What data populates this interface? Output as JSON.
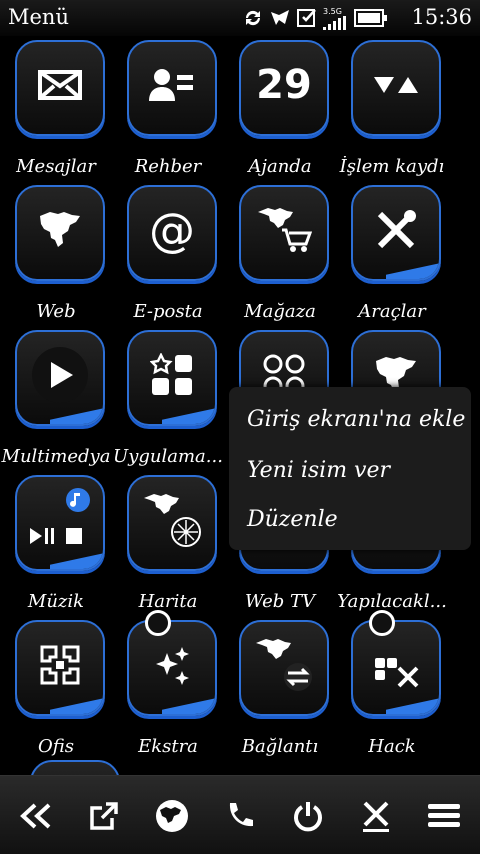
{
  "status": {
    "title": "Menü",
    "time": "15:36",
    "network": "3.5G"
  },
  "apps": [
    {
      "label": "Mesajlar",
      "icon": "envelope-icon"
    },
    {
      "label": "Rehber",
      "icon": "contacts-icon"
    },
    {
      "label": "Ajanda",
      "icon": "calendar-icon",
      "number": "29"
    },
    {
      "label": "İşlem kaydı",
      "icon": "log-icon"
    },
    {
      "label": "Web",
      "icon": "globe-icon"
    },
    {
      "label": "E-posta",
      "icon": "at-icon"
    },
    {
      "label": "Mağaza",
      "icon": "store-icon"
    },
    {
      "label": "Araçlar",
      "icon": "tools-icon"
    },
    {
      "label": "Multimedya",
      "icon": "play-icon"
    },
    {
      "label": "Uygulama...",
      "icon": "apps-icon"
    },
    {
      "label": "",
      "icon": "games-icon"
    },
    {
      "label": "",
      "icon": "globe-icon"
    },
    {
      "label": "Müzik",
      "icon": "music-icon"
    },
    {
      "label": "Harita",
      "icon": "map-icon"
    },
    {
      "label": "Web TV",
      "icon": "webtv-icon"
    },
    {
      "label": "Yapılacakl...",
      "icon": "todo-icon"
    },
    {
      "label": "Ofis",
      "icon": "office-icon"
    },
    {
      "label": "Ekstra",
      "icon": "sparkle-icon"
    },
    {
      "label": "Bağlantı",
      "icon": "connect-icon"
    },
    {
      "label": "Hack",
      "icon": "hack-icon"
    }
  ],
  "context_menu": {
    "items": [
      "Giriş ekranı'na ekle",
      "Yeni isim ver",
      "Düzenle"
    ]
  },
  "toolbar": {
    "buttons": [
      "back-icon",
      "open-icon",
      "globe-icon",
      "phone-icon",
      "power-icon",
      "close-icon",
      "menu-icon"
    ]
  },
  "colors": {
    "accent": "#2f7ae8",
    "background": "#000000"
  }
}
